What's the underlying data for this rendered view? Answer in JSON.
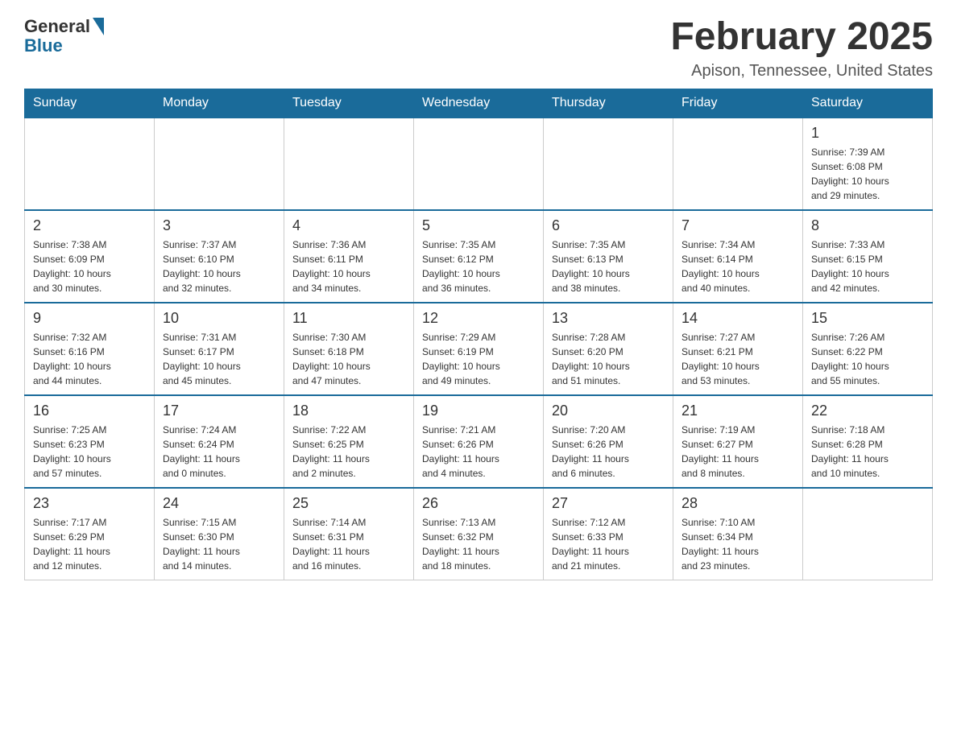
{
  "logo": {
    "general": "General",
    "blue": "Blue"
  },
  "title": "February 2025",
  "subtitle": "Apison, Tennessee, United States",
  "weekdays": [
    "Sunday",
    "Monday",
    "Tuesday",
    "Wednesday",
    "Thursday",
    "Friday",
    "Saturday"
  ],
  "weeks": [
    [
      {
        "day": "",
        "info": ""
      },
      {
        "day": "",
        "info": ""
      },
      {
        "day": "",
        "info": ""
      },
      {
        "day": "",
        "info": ""
      },
      {
        "day": "",
        "info": ""
      },
      {
        "day": "",
        "info": ""
      },
      {
        "day": "1",
        "info": "Sunrise: 7:39 AM\nSunset: 6:08 PM\nDaylight: 10 hours\nand 29 minutes."
      }
    ],
    [
      {
        "day": "2",
        "info": "Sunrise: 7:38 AM\nSunset: 6:09 PM\nDaylight: 10 hours\nand 30 minutes."
      },
      {
        "day": "3",
        "info": "Sunrise: 7:37 AM\nSunset: 6:10 PM\nDaylight: 10 hours\nand 32 minutes."
      },
      {
        "day": "4",
        "info": "Sunrise: 7:36 AM\nSunset: 6:11 PM\nDaylight: 10 hours\nand 34 minutes."
      },
      {
        "day": "5",
        "info": "Sunrise: 7:35 AM\nSunset: 6:12 PM\nDaylight: 10 hours\nand 36 minutes."
      },
      {
        "day": "6",
        "info": "Sunrise: 7:35 AM\nSunset: 6:13 PM\nDaylight: 10 hours\nand 38 minutes."
      },
      {
        "day": "7",
        "info": "Sunrise: 7:34 AM\nSunset: 6:14 PM\nDaylight: 10 hours\nand 40 minutes."
      },
      {
        "day": "8",
        "info": "Sunrise: 7:33 AM\nSunset: 6:15 PM\nDaylight: 10 hours\nand 42 minutes."
      }
    ],
    [
      {
        "day": "9",
        "info": "Sunrise: 7:32 AM\nSunset: 6:16 PM\nDaylight: 10 hours\nand 44 minutes."
      },
      {
        "day": "10",
        "info": "Sunrise: 7:31 AM\nSunset: 6:17 PM\nDaylight: 10 hours\nand 45 minutes."
      },
      {
        "day": "11",
        "info": "Sunrise: 7:30 AM\nSunset: 6:18 PM\nDaylight: 10 hours\nand 47 minutes."
      },
      {
        "day": "12",
        "info": "Sunrise: 7:29 AM\nSunset: 6:19 PM\nDaylight: 10 hours\nand 49 minutes."
      },
      {
        "day": "13",
        "info": "Sunrise: 7:28 AM\nSunset: 6:20 PM\nDaylight: 10 hours\nand 51 minutes."
      },
      {
        "day": "14",
        "info": "Sunrise: 7:27 AM\nSunset: 6:21 PM\nDaylight: 10 hours\nand 53 minutes."
      },
      {
        "day": "15",
        "info": "Sunrise: 7:26 AM\nSunset: 6:22 PM\nDaylight: 10 hours\nand 55 minutes."
      }
    ],
    [
      {
        "day": "16",
        "info": "Sunrise: 7:25 AM\nSunset: 6:23 PM\nDaylight: 10 hours\nand 57 minutes."
      },
      {
        "day": "17",
        "info": "Sunrise: 7:24 AM\nSunset: 6:24 PM\nDaylight: 11 hours\nand 0 minutes."
      },
      {
        "day": "18",
        "info": "Sunrise: 7:22 AM\nSunset: 6:25 PM\nDaylight: 11 hours\nand 2 minutes."
      },
      {
        "day": "19",
        "info": "Sunrise: 7:21 AM\nSunset: 6:26 PM\nDaylight: 11 hours\nand 4 minutes."
      },
      {
        "day": "20",
        "info": "Sunrise: 7:20 AM\nSunset: 6:26 PM\nDaylight: 11 hours\nand 6 minutes."
      },
      {
        "day": "21",
        "info": "Sunrise: 7:19 AM\nSunset: 6:27 PM\nDaylight: 11 hours\nand 8 minutes."
      },
      {
        "day": "22",
        "info": "Sunrise: 7:18 AM\nSunset: 6:28 PM\nDaylight: 11 hours\nand 10 minutes."
      }
    ],
    [
      {
        "day": "23",
        "info": "Sunrise: 7:17 AM\nSunset: 6:29 PM\nDaylight: 11 hours\nand 12 minutes."
      },
      {
        "day": "24",
        "info": "Sunrise: 7:15 AM\nSunset: 6:30 PM\nDaylight: 11 hours\nand 14 minutes."
      },
      {
        "day": "25",
        "info": "Sunrise: 7:14 AM\nSunset: 6:31 PM\nDaylight: 11 hours\nand 16 minutes."
      },
      {
        "day": "26",
        "info": "Sunrise: 7:13 AM\nSunset: 6:32 PM\nDaylight: 11 hours\nand 18 minutes."
      },
      {
        "day": "27",
        "info": "Sunrise: 7:12 AM\nSunset: 6:33 PM\nDaylight: 11 hours\nand 21 minutes."
      },
      {
        "day": "28",
        "info": "Sunrise: 7:10 AM\nSunset: 6:34 PM\nDaylight: 11 hours\nand 23 minutes."
      },
      {
        "day": "",
        "info": ""
      }
    ]
  ]
}
